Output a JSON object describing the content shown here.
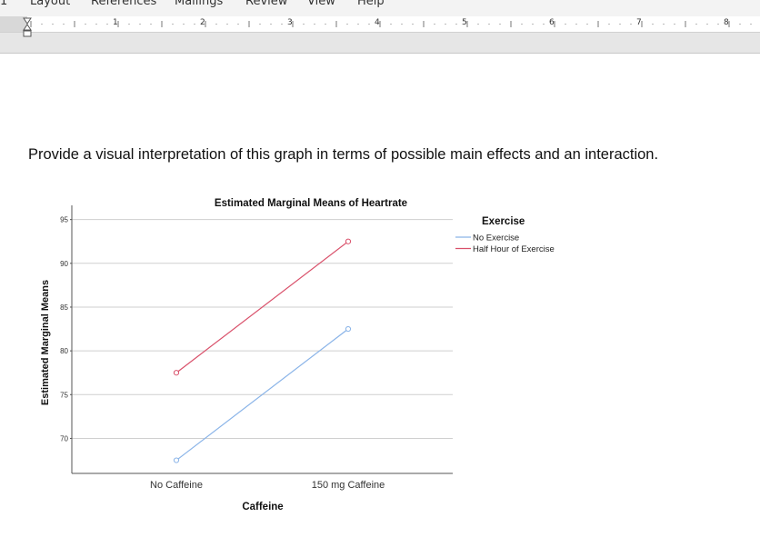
{
  "ribbon": {
    "tabs": [
      "Layout",
      "References",
      "Mailings",
      "Review",
      "View",
      "Help"
    ]
  },
  "ruler": {
    "numbers": [
      "1",
      "2",
      "3",
      "4",
      "5",
      "6",
      "7",
      "8"
    ]
  },
  "document": {
    "question": "Provide a visual interpretation of this graph in terms of possible main effects and an interaction."
  },
  "chart_data": {
    "type": "line",
    "title": "Estimated Marginal Means of Heartrate",
    "xlabel": "Caffeine",
    "ylabel": "Estimated Marginal Means",
    "categories": [
      "No Caffeine",
      "150 mg Caffeine"
    ],
    "ylim": [
      66,
      96
    ],
    "yticks": [
      70,
      75,
      80,
      85,
      90,
      95
    ],
    "grid": true,
    "legend_title": "Exercise",
    "legend_position": "right",
    "series": [
      {
        "name": "No Exercise",
        "values": [
          67.5,
          82.5
        ],
        "color": "#8ab4e8"
      },
      {
        "name": "Half Hour of Exercise",
        "values": [
          77.5,
          92.5
        ],
        "color": "#d9506a"
      }
    ]
  }
}
